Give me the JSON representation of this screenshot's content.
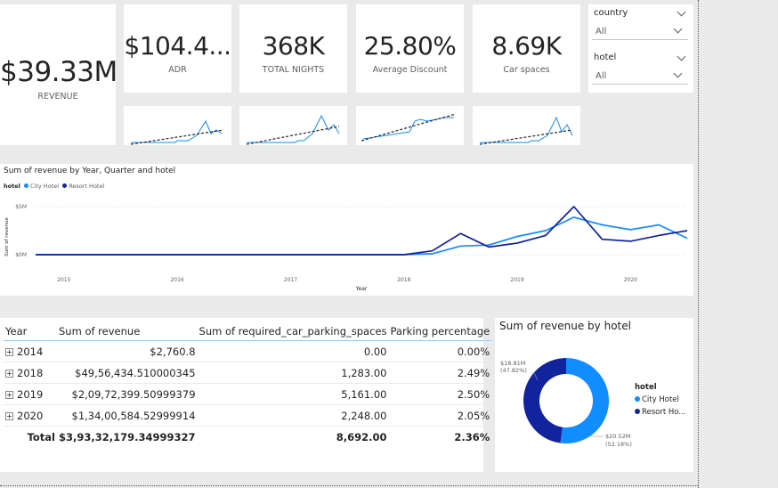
{
  "kpis": {
    "revenue": {
      "value": "$39.33M",
      "label": "REVENUE"
    },
    "adr": {
      "value": "$104.4...",
      "label": "ADR"
    },
    "nights": {
      "value": "368K",
      "label": "TOTAL NIGHTS"
    },
    "discount": {
      "value": "25.80%",
      "label": "Average  Discount"
    },
    "car": {
      "value": "8.69K",
      "label": "Car spaces"
    }
  },
  "slicers": {
    "country": {
      "title": "country",
      "value": "All"
    },
    "hotel": {
      "title": "hotel",
      "value": "All"
    }
  },
  "line_chart": {
    "title": "Sum of revenue by Year, Quarter and hotel",
    "legend_title": "hotel",
    "xlabel": "Year",
    "ylabel": "Sum of revenue"
  },
  "matrix": {
    "headers": [
      "Year",
      "Sum of revenue",
      "Sum of required_car_parking_spaces",
      "Parking percentage"
    ],
    "rows": [
      {
        "year": "2014",
        "revenue": "$2,760.8",
        "parking": "0.00",
        "pct": "0.00%"
      },
      {
        "year": "2018",
        "revenue": "$49,56,434.510000345",
        "parking": "1,283.00",
        "pct": "2.49%"
      },
      {
        "year": "2019",
        "revenue": "$2,09,72,399.50999379",
        "parking": "5,161.00",
        "pct": "2.50%"
      },
      {
        "year": "2020",
        "revenue": "$1,34,00,584.52999914",
        "parking": "2,248.00",
        "pct": "2.05%"
      }
    ],
    "total": {
      "label": "Total",
      "revenue": "$3,93,32,179.34999327",
      "parking": "8,692.00",
      "pct": "2.36%"
    }
  },
  "donut": {
    "title": "Sum of revenue by hotel",
    "legend_title": "hotel",
    "label_resort_value": "$18.81M",
    "label_resort_pct": "(47.82%)",
    "label_city_value": "$20.52M",
    "label_city_pct": "(52.18%)"
  },
  "colors": {
    "city": "#118dff",
    "resort": "#12239e",
    "trend": "#252423"
  },
  "chart_data": [
    {
      "type": "line",
      "title": "Sum of revenue by Year, Quarter and hotel",
      "xlabel": "Year",
      "ylabel": "Sum of revenue",
      "x_ticks": [
        "2015",
        "2016",
        "2017",
        "2018",
        "2019",
        "2020"
      ],
      "y_ticks": [
        "$0M",
        "$5M"
      ],
      "x": [
        2014.75,
        2015,
        2015.25,
        2015.5,
        2015.75,
        2016,
        2016.25,
        2016.5,
        2016.75,
        2017,
        2017.25,
        2017.5,
        2017.75,
        2018,
        2018.25,
        2018.5,
        2018.75,
        2019,
        2019.25,
        2019.5,
        2019.75,
        2020,
        2020.25,
        2020.5
      ],
      "ylim": [
        0,
        6
      ],
      "series": [
        {
          "name": "City Hotel",
          "values": [
            0,
            0,
            0,
            0,
            0,
            0,
            0,
            0,
            0,
            0,
            0,
            0,
            0,
            0,
            0.1,
            0.9,
            1.0,
            1.9,
            2.5,
            3.9,
            3.1,
            2.6,
            3.1,
            1.7
          ]
        },
        {
          "name": "Resort Hotel",
          "values": [
            0,
            0,
            0,
            0,
            0,
            0,
            0,
            0,
            0,
            0,
            0,
            0,
            0,
            0,
            0.4,
            2.2,
            0.8,
            1.2,
            2.0,
            5.0,
            1.6,
            1.4,
            2.0,
            2.5
          ]
        }
      ],
      "legend": "top-left",
      "grid": true
    },
    {
      "type": "pie",
      "title": "Sum of revenue by hotel",
      "categories": [
        "City Hotel",
        "Resort Hotel"
      ],
      "values": [
        20.52,
        18.81
      ],
      "percent": [
        52.18,
        47.82
      ],
      "unit": "$M"
    }
  ]
}
